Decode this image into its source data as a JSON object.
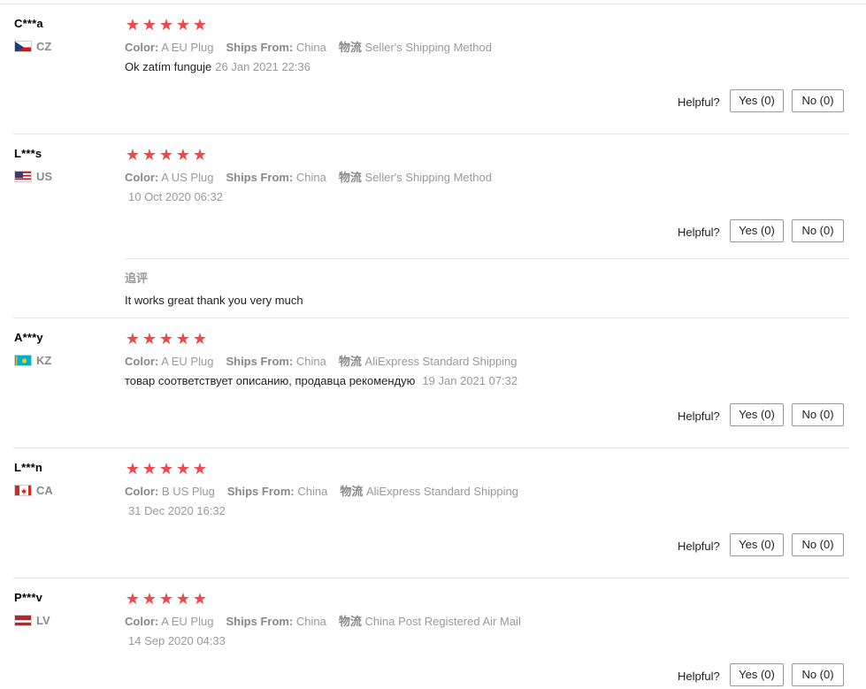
{
  "reviews": [
    {
      "user": "C***a",
      "country": "CZ",
      "flag": "cz-flag",
      "rating": 5,
      "color_label": "Color:",
      "color_value": "A EU Plug",
      "ships_label": "Ships From:",
      "ships_value": "China",
      "logistics_label": "物流",
      "logistics_value": "Seller's Shipping Method",
      "text": "Ok zatím funguje",
      "date": "26 Jan 2021 22:36",
      "helpful_label": "Helpful?",
      "yes_label": "Yes (0)",
      "no_label": "No (0)"
    },
    {
      "user": "L***s",
      "country": "US",
      "flag": "us-flag",
      "rating": 5,
      "color_label": "Color:",
      "color_value": "A US Plug",
      "ships_label": "Ships From:",
      "ships_value": "China",
      "logistics_label": "物流",
      "logistics_value": "Seller's Shipping Method",
      "text": "",
      "date": "10 Oct 2020 06:32",
      "helpful_label": "Helpful?",
      "yes_label": "Yes (0)",
      "no_label": "No (0)",
      "followup_title": "追评",
      "followup_text": "It works great thank you very much"
    },
    {
      "user": "A***y",
      "country": "KZ",
      "flag": "kz-flag",
      "rating": 5,
      "color_label": "Color:",
      "color_value": "A EU Plug",
      "ships_label": "Ships From:",
      "ships_value": "China",
      "logistics_label": "物流",
      "logistics_value": "AliExpress Standard Shipping",
      "text": "товар соответствует описанию, продавца рекомендую",
      "date": "19 Jan 2021 07:32",
      "helpful_label": "Helpful?",
      "yes_label": "Yes (0)",
      "no_label": "No (0)"
    },
    {
      "user": "L***n",
      "country": "CA",
      "flag": "ca-flag",
      "rating": 5,
      "color_label": "Color:",
      "color_value": "B US Plug",
      "ships_label": "Ships From:",
      "ships_value": "China",
      "logistics_label": "物流",
      "logistics_value": "AliExpress Standard Shipping",
      "text": "",
      "date": "31 Dec 2020 16:32",
      "helpful_label": "Helpful?",
      "yes_label": "Yes (0)",
      "no_label": "No (0)"
    },
    {
      "user": "P***v",
      "country": "LV",
      "flag": "lv-flag",
      "rating": 5,
      "color_label": "Color:",
      "color_value": "A EU Plug",
      "ships_label": "Ships From:",
      "ships_value": "China",
      "logistics_label": "物流",
      "logistics_value": "China Post Registered Air Mail",
      "text": "",
      "date": "14 Sep 2020 04:33",
      "helpful_label": "Helpful?",
      "yes_label": "Yes (0)",
      "no_label": "No (0)"
    }
  ],
  "colors": {
    "star": "#f0484a",
    "meta_gray": "#999999",
    "divider": "#e5e5e5"
  }
}
